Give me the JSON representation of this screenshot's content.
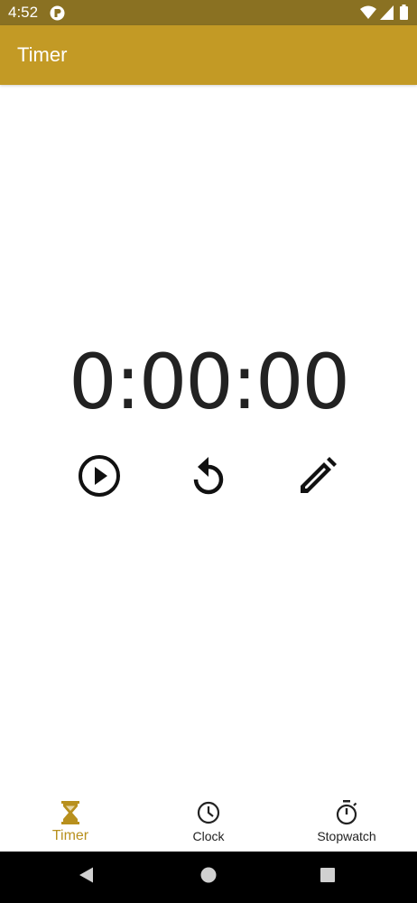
{
  "status_bar": {
    "time": "4:52",
    "icons": [
      "app-notification-icon",
      "wifi-icon",
      "signal-icon",
      "battery-icon"
    ]
  },
  "app_bar": {
    "title": "Timer",
    "color": "#c39a25"
  },
  "timer": {
    "display": "0:00:00",
    "controls": [
      "play-icon",
      "reset-icon",
      "edit-icon"
    ]
  },
  "bottom_nav": {
    "active_color": "#b8901e",
    "items": [
      {
        "label": "Timer",
        "icon": "hourglass-icon",
        "active": true
      },
      {
        "label": "Clock",
        "icon": "clock-icon",
        "active": false
      },
      {
        "label": "Stopwatch",
        "icon": "stopwatch-icon",
        "active": false
      }
    ]
  },
  "system_nav": {
    "buttons": [
      "back-icon",
      "home-icon",
      "recents-icon"
    ]
  }
}
